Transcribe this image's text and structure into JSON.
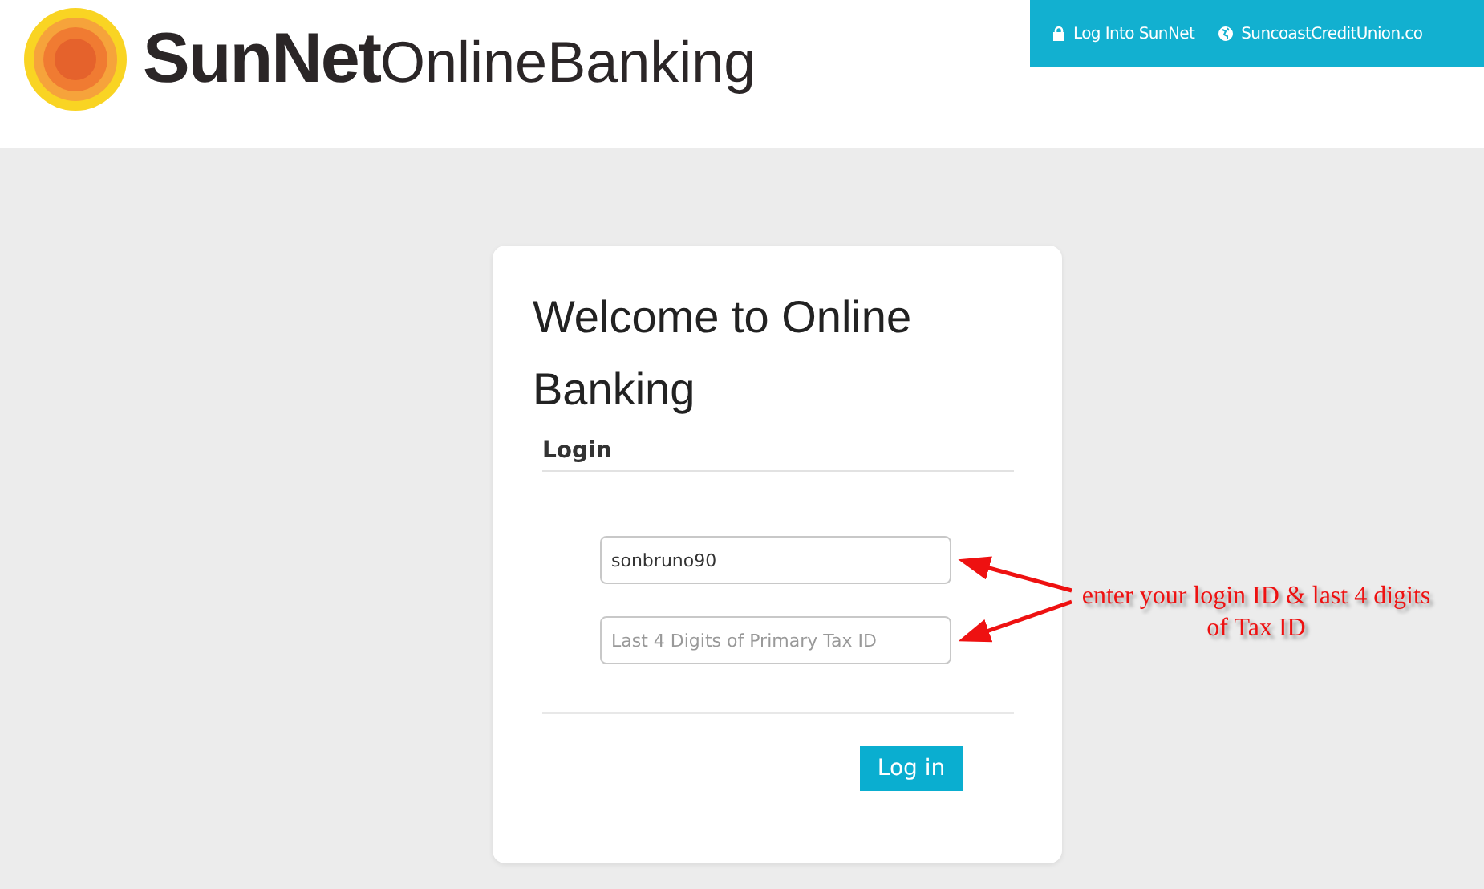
{
  "logo": {
    "brand": "SunNet",
    "suffix": "OnlineBanking"
  },
  "nav": [
    {
      "kind": "lock",
      "label": "Log Into SunNet"
    },
    {
      "kind": "globe",
      "label": "SuncoastCreditUnion.co"
    }
  ],
  "card": {
    "title": "Welcome to Online Banking",
    "section": "Login",
    "fields": [
      {
        "value": "sonbruno90"
      },
      {
        "placeholder": "Last 4 Digits of Primary Tax ID"
      }
    ],
    "button": "Log in"
  },
  "annotation": "enter your login ID & last 4 digits of Tax ID"
}
